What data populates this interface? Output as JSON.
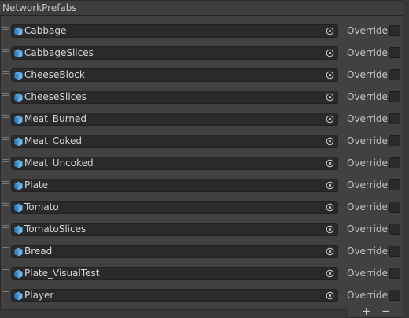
{
  "header": {
    "title": "NetworkPrefabs"
  },
  "colors": {
    "cube_icon": "#4fa3e0",
    "field_bg": "#2a2a2a",
    "panel_bg": "#414141"
  },
  "icons": {
    "item": "prefab-cube-icon",
    "picker": "object-picker-icon",
    "handle": "drag-handle-icon"
  },
  "items": [
    {
      "label": "Cabbage",
      "override_label": "Override",
      "override_checked": false
    },
    {
      "label": "CabbageSlices",
      "override_label": "Override",
      "override_checked": false
    },
    {
      "label": "CheeseBlock",
      "override_label": "Override",
      "override_checked": false
    },
    {
      "label": "CheeseSlices",
      "override_label": "Override",
      "override_checked": false
    },
    {
      "label": "Meat_Burned",
      "override_label": "Override",
      "override_checked": false
    },
    {
      "label": "Meat_Coked",
      "override_label": "Override",
      "override_checked": false
    },
    {
      "label": "Meat_Uncoked",
      "override_label": "Override",
      "override_checked": false
    },
    {
      "label": "Plate",
      "override_label": "Override",
      "override_checked": false
    },
    {
      "label": "Tomato",
      "override_label": "Override",
      "override_checked": false
    },
    {
      "label": "TomatoSlices",
      "override_label": "Override",
      "override_checked": false
    },
    {
      "label": "Bread",
      "override_label": "Override",
      "override_checked": false
    },
    {
      "label": "Plate_VisualTest",
      "override_label": "Override",
      "override_checked": false
    },
    {
      "label": "Player",
      "override_label": "Override",
      "override_checked": false
    }
  ],
  "footer": {
    "add_label": "+",
    "remove_label": "−"
  }
}
